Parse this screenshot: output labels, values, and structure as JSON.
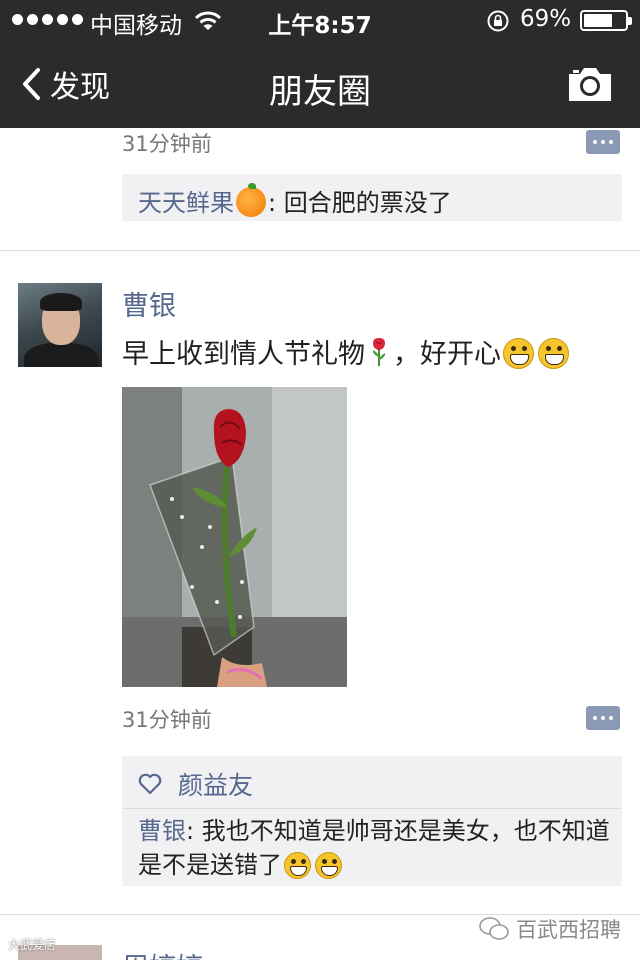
{
  "status_bar": {
    "carrier": "中国移动",
    "time": "上午8:57",
    "battery": "69%",
    "battery_level": 0.69
  },
  "nav": {
    "back_label": "发现",
    "title": "朋友圈"
  },
  "previous_post": {
    "time": "31分钟前",
    "comment": {
      "author": "天天鲜果",
      "text": ": 回合肥的票没了"
    }
  },
  "post": {
    "author": "曹银",
    "text": "早上收到情人节礼物",
    "text_after_rose": "，好开心",
    "time": "31分钟前",
    "likes": [
      "颜益友"
    ],
    "comments": [
      {
        "author": "曹银",
        "text": ": 我也不知道是帅哥还是美女，也不知道是不是送错了"
      }
    ]
  },
  "next_post": {
    "author": "周婷婷"
  },
  "watermarks": {
    "left": "大武爱店",
    "right": "百武西招聘"
  },
  "colors": {
    "header_bg": "#2b2b2d",
    "link": "#56688e",
    "comment_bg": "#f1f1f3",
    "comment_button": "#8a9ab5"
  }
}
